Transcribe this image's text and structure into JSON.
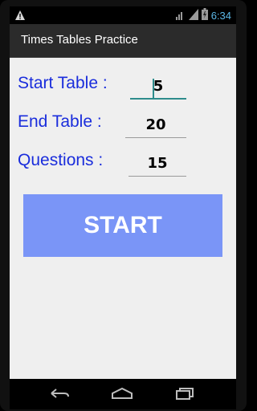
{
  "status_bar": {
    "time": "6:34",
    "warning_icon": "warning-icon",
    "wifi_icon": "wifi-icon",
    "signal_icon": "signal-icon",
    "battery_icon": "battery-icon",
    "accent_color": "#5bb7e6"
  },
  "action_bar": {
    "title": "Times Tables Practice"
  },
  "form": {
    "start_table_label": "Start Table :",
    "start_table_value": "5",
    "end_table_label": "End Table :",
    "end_table_value": "20",
    "questions_label": "Questions :",
    "questions_value": "15",
    "label_color": "#1a2ddc"
  },
  "start_button": {
    "label": "START",
    "color": "#7a95f7"
  },
  "nav_bar": {
    "back_icon": "back-icon",
    "home_icon": "home-icon",
    "recent_icon": "recent-apps-icon"
  }
}
